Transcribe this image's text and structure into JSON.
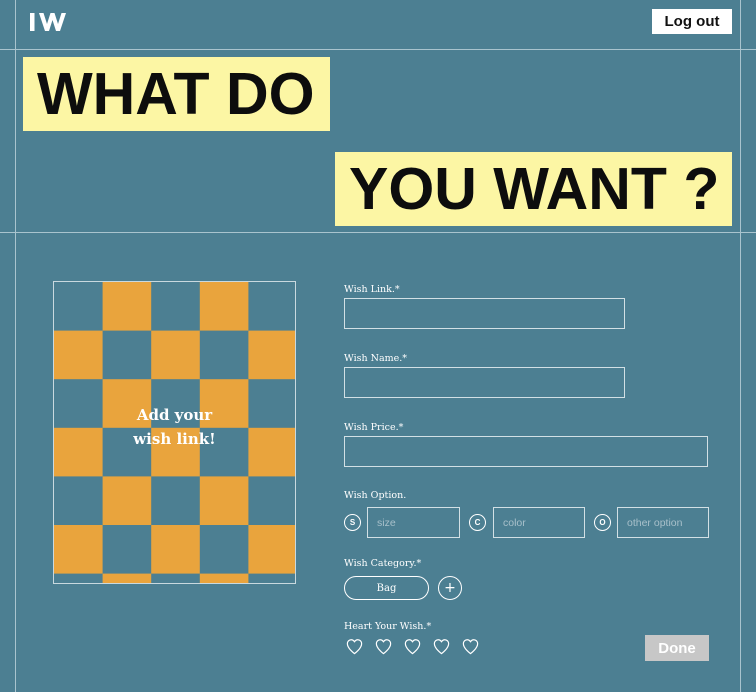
{
  "header": {
    "logo_text": "IWI",
    "logout_label": "Log out"
  },
  "hero": {
    "line1": "WHAT DO",
    "line2": "YOU WANT ?"
  },
  "preview": {
    "text_line1": "Add your",
    "text_line2": "wish link!",
    "colors": {
      "orange": "#e9a43d",
      "teal": "#4c7f92"
    }
  },
  "form": {
    "wish_link_label": "Wish Link.*",
    "wish_link_value": "",
    "wish_name_label": "Wish Name.*",
    "wish_name_value": "",
    "wish_price_label": "Wish Price.*",
    "wish_price_value": "",
    "wish_option_label": "Wish Option.",
    "options": [
      {
        "badge": "S",
        "placeholder": "size"
      },
      {
        "badge": "C",
        "placeholder": "color"
      },
      {
        "badge": "O",
        "placeholder": "other option"
      }
    ],
    "wish_category_label": "Wish Category.*",
    "category_selected": "Bag",
    "add_category_symbol": "+",
    "heart_label": "Heart Your Wish.*",
    "hearts_total": 5,
    "hearts_selected": 0,
    "done_label": "Done"
  },
  "colors": {
    "background": "#4c7f92",
    "highlight": "#fcf6a4",
    "accent_orange": "#e9a43d",
    "disabled_button": "#c7c7c7"
  }
}
